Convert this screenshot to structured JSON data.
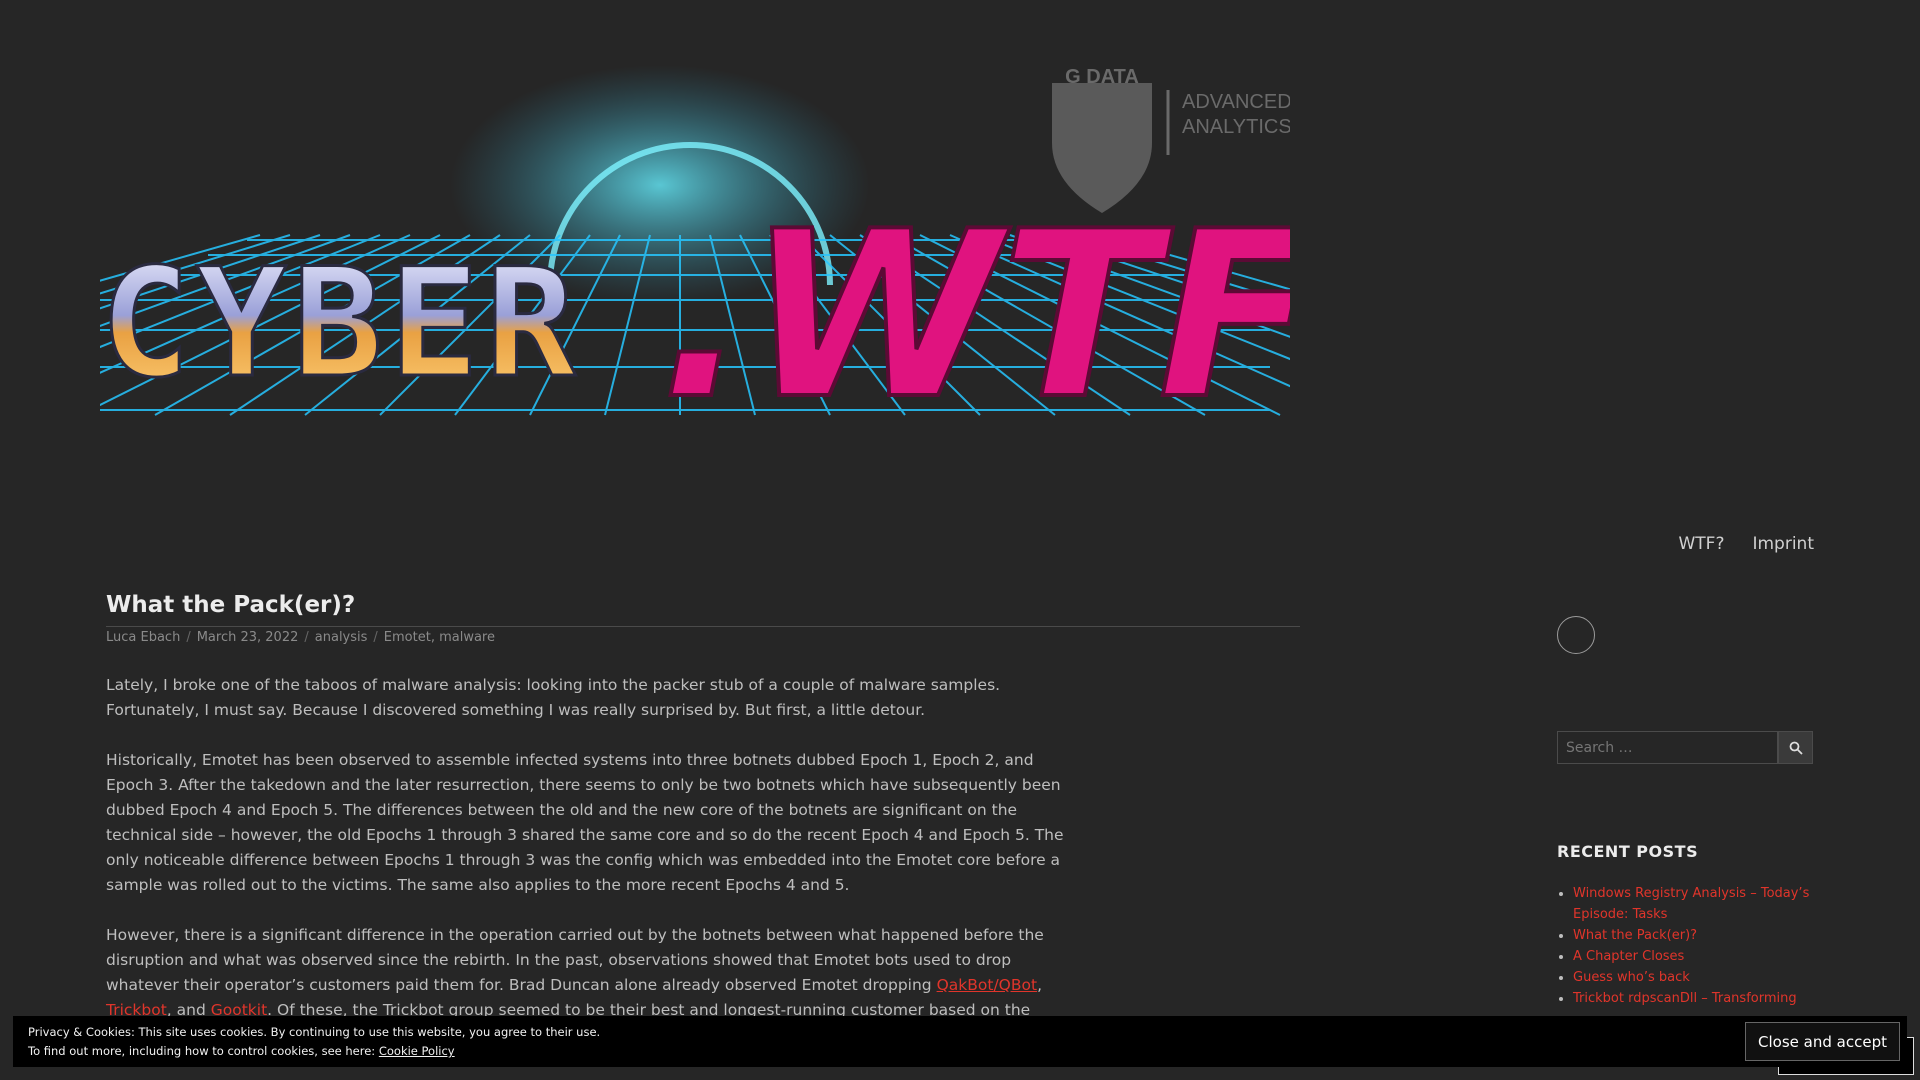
{
  "nav": {
    "items": [
      "WTF?",
      "Imprint"
    ]
  },
  "post": {
    "title": "What the Pack(er)?",
    "author": "Luca Ebach",
    "date": "March 23, 2022",
    "category": "analysis",
    "tags": "Emotet, malware",
    "paragraphs": [
      "Lately, I broke one of the taboos of malware analysis: looking into the packer stub of a couple of malware samples. Fortunately, I must say. Because I discovered something I was really surprised by. But first, a little detour.",
      "Historically, Emotet has been observed to assemble infected systems into three botnets dubbed Epoch 1, Epoch 2, and Epoch 3. After the takedown and the later resurrection, there seems to only be two botnets which have subsequently been dubbed Epoch 4 and Epoch 5. The differences between the old and the new core of the botnets are significant on the technical side – however, the old Epochs 1 through 3 shared the same core and so do the recent Epoch 4 and Epoch 5. The only noticeable difference between Epochs 1 through 3 was the config which was embedded into the Emotet core before a sample was rolled out to the victims. The same also applies to the more recent Epochs 4 and 5."
    ],
    "p3": {
      "text_a": "However, there is a significant difference in the operation carried out by the botnets between what happened before the disruption and what was observed since the rebirth. In the past, observations showed that Emotet bots used to drop whatever their operator’s customers paid them for. Brad Duncan alone already observed Emotet dropping ",
      "link_qakbot": "QakBot/QBot",
      "comma": ", ",
      "link_trickbot": "Trickbot",
      "and": ", and ",
      "link_gootkit": "Gootkit",
      "text_b": ". Of these, the Trickbot group seemed to be their best and longest-running customer based on the numerous"
    }
  },
  "sidebar": {
    "search_placeholder": "Search …",
    "recent_heading": "RECENT POSTS",
    "recent_posts": [
      "Windows Registry Analysis – Today’s Episode: Tasks",
      "What the Pack(er)?",
      "A Chapter Closes",
      "Guess who’s back",
      "Trickbot rdpscanDll – Transforming"
    ]
  },
  "cookie": {
    "line1": "Privacy & Cookies: This site uses cookies. By continuing to use this website, you agree to their use.",
    "line2": "To find out more, including how to control cookies, see here: ",
    "link": "Cookie Policy",
    "button": "Close and accept"
  },
  "logo": {
    "brand_left": "CYBER",
    "brand_right": ".WTF",
    "gdata": "G DATA",
    "advanced": "ADVANCED",
    "analytics": "ANALYTICS"
  },
  "colors": {
    "background": "#262626",
    "link": "#e0352b",
    "brand_pink": "#e0137f",
    "grid_cyan": "#27c6ff"
  },
  "icons": {
    "search": "search-icon",
    "avatar": "avatar"
  }
}
